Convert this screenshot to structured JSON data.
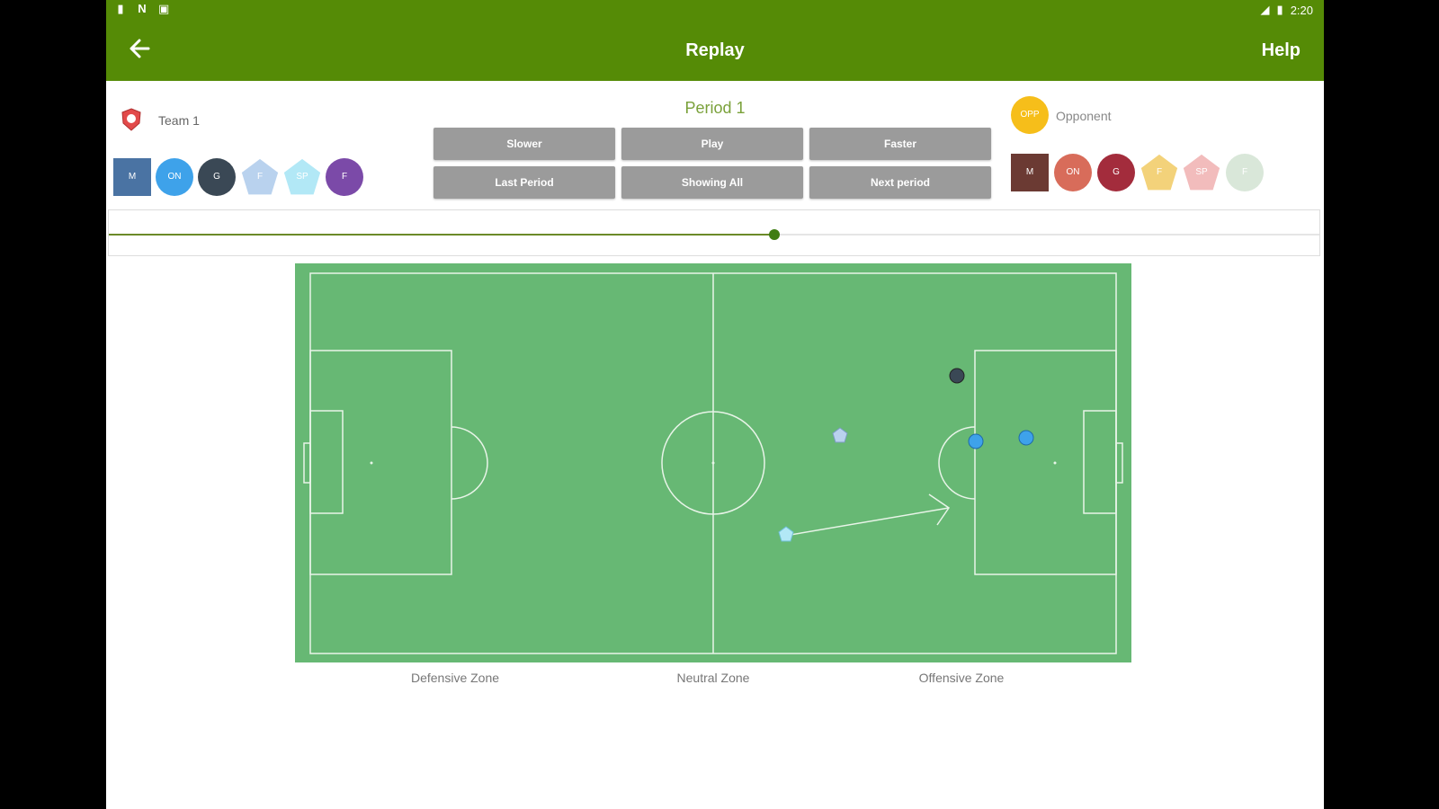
{
  "status_bar": {
    "time": "2:20"
  },
  "app_bar": {
    "title": "Replay",
    "help_label": "Help"
  },
  "team": {
    "name": "Team 1",
    "tokens": [
      {
        "label": "M",
        "shape": "square",
        "color": "#4a73a3"
      },
      {
        "label": "ON",
        "shape": "circle",
        "color": "#3ea2ea"
      },
      {
        "label": "G",
        "shape": "circle",
        "color": "#3a4855"
      },
      {
        "label": "F",
        "shape": "pentagon",
        "color": "#b9d2ee"
      },
      {
        "label": "SP",
        "shape": "pentagon",
        "color": "#b2e8f6"
      },
      {
        "label": "F",
        "shape": "circle",
        "color": "#7b4aa8"
      }
    ]
  },
  "opponent": {
    "logo_label": "OPP",
    "name": "Opponent",
    "tokens": [
      {
        "label": "M",
        "shape": "square",
        "color": "#6b3a33"
      },
      {
        "label": "ON",
        "shape": "circle",
        "color": "#d86c5a"
      },
      {
        "label": "G",
        "shape": "circle",
        "color": "#a32c3c"
      },
      {
        "label": "F",
        "shape": "pentagon",
        "color": "#f3d27a"
      },
      {
        "label": "SP",
        "shape": "pentagon",
        "color": "#f2bcbc"
      },
      {
        "label": "F",
        "shape": "circle",
        "color": "#d9e7d9"
      }
    ]
  },
  "period": "Period 1",
  "controls": {
    "slower": "Slower",
    "play": "Play",
    "faster": "Faster",
    "last_period": "Last Period",
    "showing_all": "Showing All",
    "next_period": "Next period"
  },
  "timeline": {
    "progress": 0.55
  },
  "zones": {
    "defensive": "Defensive Zone",
    "neutral": "Neutral Zone",
    "offensive": "Offensive Zone"
  },
  "colors": {
    "app_bar": "#558b06",
    "pitch": "#67b874",
    "button": "#9b9b9b",
    "period_text": "#7aa13a"
  }
}
